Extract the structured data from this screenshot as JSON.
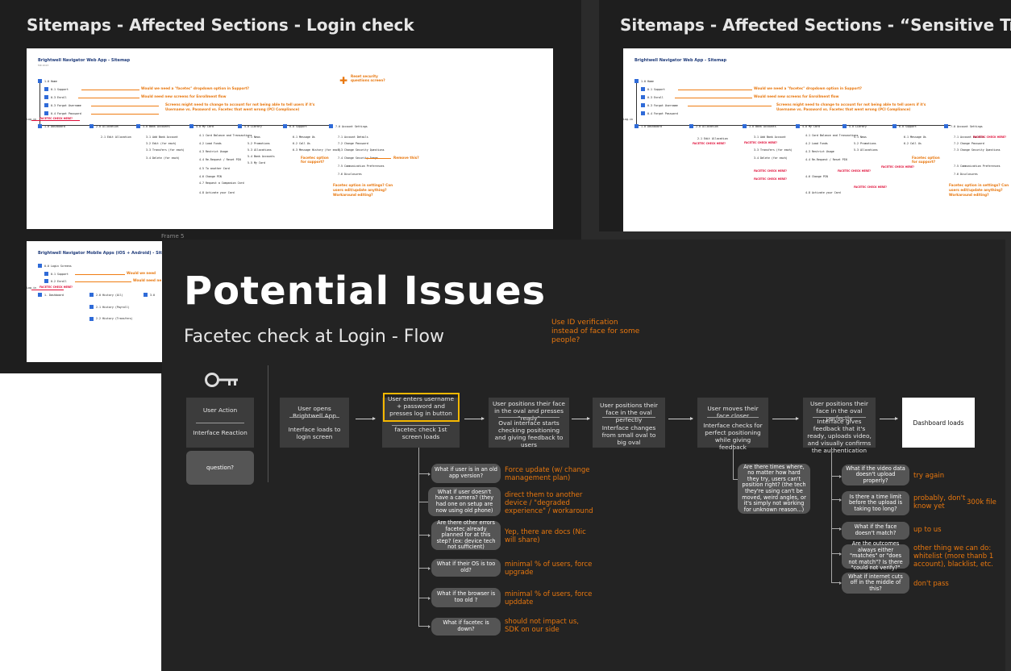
{
  "frames": {
    "login_title": "Sitemaps - Affected Sections - Login check",
    "sensitive_title": "Sitemaps - Affected Sections - “Sensitive Trans",
    "frame5_label": "Frame 5"
  },
  "web_sitemap": {
    "title": "Brightwell Navigator Web App - Sitemap",
    "subtitle": "MR 2023",
    "login": "Log-in",
    "home": "1.0 Home",
    "items": [
      "0.1 Support",
      "0.3 Enroll",
      "0.3 Forgot Username",
      "0.4 Forgot Password"
    ],
    "sections": [
      "1.0 Dashboard",
      "2.0 Allocation",
      "3.0 Bank Accounts",
      "4.0 My Card",
      "5.0 Library",
      "6.0 Support",
      "7.0 Account Settings"
    ],
    "col_allocation": [
      "2.1 Edit Allocation"
    ],
    "col_bank": [
      "3.1 Add Bank Account",
      "3.2 Edit (for each)",
      "3.3 Transfers (for each)",
      "3.4 Delete (for each)"
    ],
    "col_card": [
      "4.1 Card Balance and Transactions",
      "4.2 Load Funds",
      "4.3 Restrict Usage",
      "4.4 Re-Request / Reset PIN",
      "4.5 To another Card",
      "4.6 Change PIN",
      "4.7 Request a Companion Card",
      "4.8 Activate your Card"
    ],
    "col_library": [
      "5.1 News",
      "5.2 Promotions",
      "5.3 Allocations",
      "5.4 Bank Accounts",
      "5.5 My Card"
    ],
    "col_support": [
      "6.1 Message Us",
      "6.2 Call Us",
      "6.3 Message History (for each)"
    ],
    "col_settings": [
      "7.1 Account Details",
      "7.2 Change Password",
      "7.3 Change Security Questions",
      "7.4 Change Security Image",
      "7.5 Communication Preferences",
      "7.6 Disclosures"
    ],
    "notes": {
      "support": "Would we need a \"facetec\" dropdown option in Support?",
      "enroll": "Would need new screens for Enrollment flow",
      "screens1": "Screens might need to change to account for not being able to tell users if it's",
      "screens2": "Username vs. Password vs. Facetec that went wrong (PCI Compliance)",
      "reset1": "Reset security",
      "reset2": "questions screen?",
      "facetec_opt1": "Facetec option",
      "facetec_opt2": "for support?",
      "remove": "Remove this?",
      "settings1": "Facetec option in settings? Can",
      "settings2": "users edit/update anything?",
      "settings3": "Workaround editing?",
      "check": "FACETEC CHECK HERE?"
    }
  },
  "mobile_sitemap": {
    "title": "Brightwell Navigator Mobile Apps (iOS + Android) - Sitemap",
    "items": [
      "0.0 Login Screens",
      "0.1 Support",
      "0.2 Enroll"
    ],
    "sections": [
      "1. Dashboard",
      "2.0 History (All)",
      "2.1 History (Payroll)",
      "2.2 History (Transfers)",
      "3.0"
    ],
    "note1": "Would we need",
    "note2": "Would need ne"
  },
  "main": {
    "title": "Potential Issues",
    "subtitle": "Facetec check at Login - Flow",
    "note_id": "Use ID verification instead of face for some people?",
    "legend": {
      "action": "User Action",
      "reaction": "Interface Reaction",
      "question": "question?"
    },
    "steps": [
      {
        "action": "User opens Brightwell App",
        "reaction": "Interface loads to login screen"
      },
      {
        "action": "User enters username + password and presses log in button",
        "reaction": "facetec check 1st screen loads"
      },
      {
        "action": "User positions their face in the oval and presses \"ready\"",
        "reaction": "Oval interface starts checking positioning and giving feedback to users"
      },
      {
        "action": "User positions their face in the oval perfectly",
        "reaction": "Interface changes from small oval to big oval"
      },
      {
        "action": "User moves their face closer",
        "reaction": "Interface checks for perfect positioning while giving feedback"
      },
      {
        "action": "User positions their face in the oval perfectly",
        "reaction": "Interface gives feedback that it's ready, uploads video, and visually confirms the authentication"
      }
    ],
    "final_step": "Dashboard loads",
    "questions_a": [
      {
        "q": "What if user is in an old app version?",
        "a": "Force update (w/ change management plan)"
      },
      {
        "q": "What if user doesn't have a camera? (they had one on setup are now using old phone)",
        "a": "direct them to another device / \"degraded experience\" / workaround"
      },
      {
        "q": "Are there other errors facetec already planned for at this step? (ex: device tech not sufficient)",
        "a": "Yep, there are docs (Nic will share)"
      },
      {
        "q": "What if their OS is too old?",
        "a": "minimal % of users, force upgrade"
      },
      {
        "q": "What if the browser is too old ?",
        "a": "minimal % of users, force upddate"
      },
      {
        "q": "What if facetec is down?",
        "a": "should not impact us, SDK on our side"
      }
    ],
    "question_b": "Are there times where, no matter how hard they try, users can't position right? (the tech they're using can't be moved, weird angles, or it's simply not working for unknown reason...)",
    "questions_c": [
      {
        "q": "What if the video data doesn't upload properly?",
        "a": "try again"
      },
      {
        "q": "Is there a time limit before the upload is taking too long?",
        "a": "probably, don't know yet"
      },
      {
        "q": "What if the face doesn't match?",
        "a": "up to us"
      },
      {
        "q": "Are the outcomes always either \"matches\" or \"does not match\"? Is there \"could not verify?\"",
        "a": "other thing we can do: whitelist (more thanb 1 account), blacklist, etc."
      },
      {
        "q": "What if internet cuts off in the middle of this?",
        "a": "don't pass"
      }
    ],
    "file_note": "300k file"
  },
  "colors": {
    "accent": "#e8770e",
    "highlight": "#f5b700",
    "blue": "#2f6bd8",
    "red": "#e0103a"
  },
  "icons": {
    "legend": "key-icon"
  }
}
